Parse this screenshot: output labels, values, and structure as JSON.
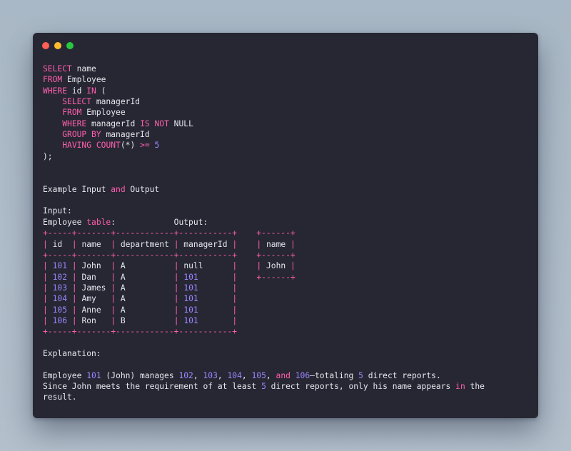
{
  "window": {
    "controls": [
      "close",
      "minimize",
      "zoom"
    ]
  },
  "colors": {
    "keyword": "#ff5fae",
    "number": "#9a86ff",
    "text": "#e6e6ee",
    "background": "#272733"
  },
  "lines": [
    [
      {
        "t": "SELECT",
        "c": "kw"
      },
      {
        "t": " name",
        "c": "tx"
      }
    ],
    [
      {
        "t": "FROM",
        "c": "kw"
      },
      {
        "t": " Employee",
        "c": "tx"
      }
    ],
    [
      {
        "t": "WHERE",
        "c": "kw"
      },
      {
        "t": " id ",
        "c": "tx"
      },
      {
        "t": "IN",
        "c": "kw"
      },
      {
        "t": " (",
        "c": "tx"
      }
    ],
    [
      {
        "t": "    ",
        "c": "tx"
      },
      {
        "t": "SELECT",
        "c": "kw"
      },
      {
        "t": " managerId",
        "c": "tx"
      }
    ],
    [
      {
        "t": "    ",
        "c": "tx"
      },
      {
        "t": "FROM",
        "c": "kw"
      },
      {
        "t": " Employee",
        "c": "tx"
      }
    ],
    [
      {
        "t": "    ",
        "c": "tx"
      },
      {
        "t": "WHERE",
        "c": "kw"
      },
      {
        "t": " managerId ",
        "c": "tx"
      },
      {
        "t": "IS NOT",
        "c": "kw"
      },
      {
        "t": " NULL",
        "c": "tx"
      }
    ],
    [
      {
        "t": "    ",
        "c": "tx"
      },
      {
        "t": "GROUP BY",
        "c": "kw"
      },
      {
        "t": " managerId",
        "c": "tx"
      }
    ],
    [
      {
        "t": "    ",
        "c": "tx"
      },
      {
        "t": "HAVING",
        "c": "kw"
      },
      {
        "t": " ",
        "c": "tx"
      },
      {
        "t": "COUNT",
        "c": "kw"
      },
      {
        "t": "(*) ",
        "c": "tx"
      },
      {
        "t": ">=",
        "c": "kw"
      },
      {
        "t": " ",
        "c": "tx"
      },
      {
        "t": "5",
        "c": "num"
      }
    ],
    [
      {
        "t": ");",
        "c": "tx"
      }
    ],
    [],
    [],
    [
      {
        "t": "Example Input ",
        "c": "tx"
      },
      {
        "t": "and",
        "c": "kw"
      },
      {
        "t": " Output",
        "c": "tx"
      }
    ],
    [],
    [
      {
        "t": "Input:",
        "c": "tx"
      }
    ],
    [
      {
        "t": "Employee ",
        "c": "tx"
      },
      {
        "t": "table",
        "c": "kw"
      },
      {
        "t": ":            Output:",
        "c": "tx"
      }
    ],
    [
      {
        "t": "+-----+-------+------------+-----------+    +------+",
        "c": "bd"
      }
    ],
    [
      {
        "t": "|",
        "c": "bd"
      },
      {
        "t": " id  ",
        "c": "tx"
      },
      {
        "t": "|",
        "c": "bd"
      },
      {
        "t": " name  ",
        "c": "tx"
      },
      {
        "t": "|",
        "c": "bd"
      },
      {
        "t": " department ",
        "c": "tx"
      },
      {
        "t": "|",
        "c": "bd"
      },
      {
        "t": " managerId ",
        "c": "tx"
      },
      {
        "t": "|",
        "c": "bd"
      },
      {
        "t": "    ",
        "c": "tx"
      },
      {
        "t": "|",
        "c": "bd"
      },
      {
        "t": " name ",
        "c": "tx"
      },
      {
        "t": "|",
        "c": "bd"
      }
    ],
    [
      {
        "t": "+-----+-------+------------+-----------+    +------+",
        "c": "bd"
      }
    ],
    [
      {
        "t": "|",
        "c": "bd"
      },
      {
        "t": " ",
        "c": "tx"
      },
      {
        "t": "101",
        "c": "num"
      },
      {
        "t": " ",
        "c": "tx"
      },
      {
        "t": "|",
        "c": "bd"
      },
      {
        "t": " John  ",
        "c": "tx"
      },
      {
        "t": "|",
        "c": "bd"
      },
      {
        "t": " A          ",
        "c": "tx"
      },
      {
        "t": "|",
        "c": "bd"
      },
      {
        "t": " null      ",
        "c": "tx"
      },
      {
        "t": "|",
        "c": "bd"
      },
      {
        "t": "    ",
        "c": "tx"
      },
      {
        "t": "|",
        "c": "bd"
      },
      {
        "t": " John ",
        "c": "tx"
      },
      {
        "t": "|",
        "c": "bd"
      }
    ],
    [
      {
        "t": "|",
        "c": "bd"
      },
      {
        "t": " ",
        "c": "tx"
      },
      {
        "t": "102",
        "c": "num"
      },
      {
        "t": " ",
        "c": "tx"
      },
      {
        "t": "|",
        "c": "bd"
      },
      {
        "t": " Dan   ",
        "c": "tx"
      },
      {
        "t": "|",
        "c": "bd"
      },
      {
        "t": " A          ",
        "c": "tx"
      },
      {
        "t": "|",
        "c": "bd"
      },
      {
        "t": " ",
        "c": "tx"
      },
      {
        "t": "101",
        "c": "num"
      },
      {
        "t": "       ",
        "c": "tx"
      },
      {
        "t": "|",
        "c": "bd"
      },
      {
        "t": "    ",
        "c": "tx"
      },
      {
        "t": "+------+",
        "c": "bd"
      }
    ],
    [
      {
        "t": "|",
        "c": "bd"
      },
      {
        "t": " ",
        "c": "tx"
      },
      {
        "t": "103",
        "c": "num"
      },
      {
        "t": " ",
        "c": "tx"
      },
      {
        "t": "|",
        "c": "bd"
      },
      {
        "t": " James ",
        "c": "tx"
      },
      {
        "t": "|",
        "c": "bd"
      },
      {
        "t": " A          ",
        "c": "tx"
      },
      {
        "t": "|",
        "c": "bd"
      },
      {
        "t": " ",
        "c": "tx"
      },
      {
        "t": "101",
        "c": "num"
      },
      {
        "t": "       ",
        "c": "tx"
      },
      {
        "t": "|",
        "c": "bd"
      }
    ],
    [
      {
        "t": "|",
        "c": "bd"
      },
      {
        "t": " ",
        "c": "tx"
      },
      {
        "t": "104",
        "c": "num"
      },
      {
        "t": " ",
        "c": "tx"
      },
      {
        "t": "|",
        "c": "bd"
      },
      {
        "t": " Amy   ",
        "c": "tx"
      },
      {
        "t": "|",
        "c": "bd"
      },
      {
        "t": " A          ",
        "c": "tx"
      },
      {
        "t": "|",
        "c": "bd"
      },
      {
        "t": " ",
        "c": "tx"
      },
      {
        "t": "101",
        "c": "num"
      },
      {
        "t": "       ",
        "c": "tx"
      },
      {
        "t": "|",
        "c": "bd"
      }
    ],
    [
      {
        "t": "|",
        "c": "bd"
      },
      {
        "t": " ",
        "c": "tx"
      },
      {
        "t": "105",
        "c": "num"
      },
      {
        "t": " ",
        "c": "tx"
      },
      {
        "t": "|",
        "c": "bd"
      },
      {
        "t": " Anne  ",
        "c": "tx"
      },
      {
        "t": "|",
        "c": "bd"
      },
      {
        "t": " A          ",
        "c": "tx"
      },
      {
        "t": "|",
        "c": "bd"
      },
      {
        "t": " ",
        "c": "tx"
      },
      {
        "t": "101",
        "c": "num"
      },
      {
        "t": "       ",
        "c": "tx"
      },
      {
        "t": "|",
        "c": "bd"
      }
    ],
    [
      {
        "t": "|",
        "c": "bd"
      },
      {
        "t": " ",
        "c": "tx"
      },
      {
        "t": "106",
        "c": "num"
      },
      {
        "t": " ",
        "c": "tx"
      },
      {
        "t": "|",
        "c": "bd"
      },
      {
        "t": " Ron   ",
        "c": "tx"
      },
      {
        "t": "|",
        "c": "bd"
      },
      {
        "t": " B          ",
        "c": "tx"
      },
      {
        "t": "|",
        "c": "bd"
      },
      {
        "t": " ",
        "c": "tx"
      },
      {
        "t": "101",
        "c": "num"
      },
      {
        "t": "       ",
        "c": "tx"
      },
      {
        "t": "|",
        "c": "bd"
      }
    ],
    [
      {
        "t": "+-----+-------+------------+-----------+",
        "c": "bd"
      }
    ],
    [],
    [
      {
        "t": "Explanation:",
        "c": "tx"
      }
    ],
    [],
    [
      {
        "t": "Employee ",
        "c": "tx"
      },
      {
        "t": "101",
        "c": "num"
      },
      {
        "t": " (John) manages ",
        "c": "tx"
      },
      {
        "t": "102",
        "c": "num"
      },
      {
        "t": ", ",
        "c": "tx"
      },
      {
        "t": "103",
        "c": "num"
      },
      {
        "t": ", ",
        "c": "tx"
      },
      {
        "t": "104",
        "c": "num"
      },
      {
        "t": ", ",
        "c": "tx"
      },
      {
        "t": "105",
        "c": "num"
      },
      {
        "t": ", ",
        "c": "tx"
      },
      {
        "t": "and",
        "c": "kw"
      },
      {
        "t": " ",
        "c": "tx"
      },
      {
        "t": "106",
        "c": "num"
      },
      {
        "t": "—totaling ",
        "c": "tx"
      },
      {
        "t": "5",
        "c": "num"
      },
      {
        "t": " direct reports.",
        "c": "tx"
      }
    ],
    [
      {
        "t": "Since John meets the requirement of at least ",
        "c": "tx"
      },
      {
        "t": "5",
        "c": "num"
      },
      {
        "t": " direct reports, only his name appears ",
        "c": "tx"
      },
      {
        "t": "in",
        "c": "kw"
      },
      {
        "t": " the",
        "c": "tx"
      }
    ],
    [
      {
        "t": "result.",
        "c": "tx"
      }
    ]
  ]
}
